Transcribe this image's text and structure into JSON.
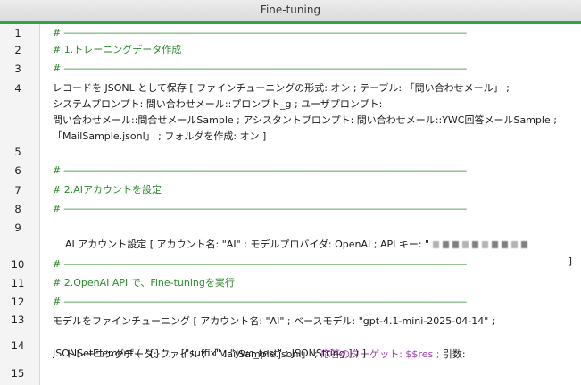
{
  "window": {
    "title": "Fine-tuning"
  },
  "lines": {
    "l1": "# ―――――――――――――――――――――――――――――――――――――――――",
    "l2": "# 1.トレーニングデータ作成",
    "l3": "# ―――――――――――――――――――――――――――――――――――――――――",
    "l4a": "レコードを JSONL として保存 [ ファインチューニングの形式: オン ; テーブル: 「問い合わせメール」 ;",
    "l4b": "システムプロンプト: 問い合わせメール::プロンプト_g ; ユーザプロンプト:",
    "l4c": "問い合わせメール::問合せメールSample ; アシスタントプロンプト: 問い合わせメール::YWC回答メールSample ;",
    "l4d": "「MailSample.jsonl」 ; フォルダを作成: オン ]",
    "l6": "# ―――――――――――――――――――――――――――――――――――――――――",
    "l7": "# 2.AIアカウントを設定",
    "l8": "# ―――――――――――――――――――――――――――――――――――――――――",
    "l9a": "AI アカウント設定 [ アカウント名: \"AI\" ; モデルプロバイダ: OpenAI ; API キー: \"",
    "l9b": "]",
    "l11": "# ―――――――――――――――――――――――――――――――――――――――――",
    "l12": "# 2.OpenAI API で、Fine-tuningを実行",
    "l13": "# ―――――――――――――――――――――――――――――――――――――――――",
    "l14a": "モデルをファインチューニング [ アカウント名: \"AI\" ; ベースモデル: \"gpt-4.1-mini-2025-04-14\" ;",
    "l14b1": "トレーニングデータ: ファイル ; 「MailSample.jsonl」 ; ",
    "l14b2": "応答のターゲット: $$res ;",
    "l14b3": " 引数:",
    "l14c": "JSONSetElement ( \"{}\" ;   [\"suffix\" ; \"ywc_test\" ; JSONString ] ) ]"
  },
  "line_numbers": [
    "1",
    "2",
    "3",
    "4",
    "5",
    "6",
    "7",
    "8",
    "9",
    "10",
    "11",
    "12",
    "13",
    "14",
    "15"
  ],
  "colors": {
    "accent": "#2ea34a",
    "comment": "#2a8a2a",
    "target": "#9a3fb0"
  }
}
